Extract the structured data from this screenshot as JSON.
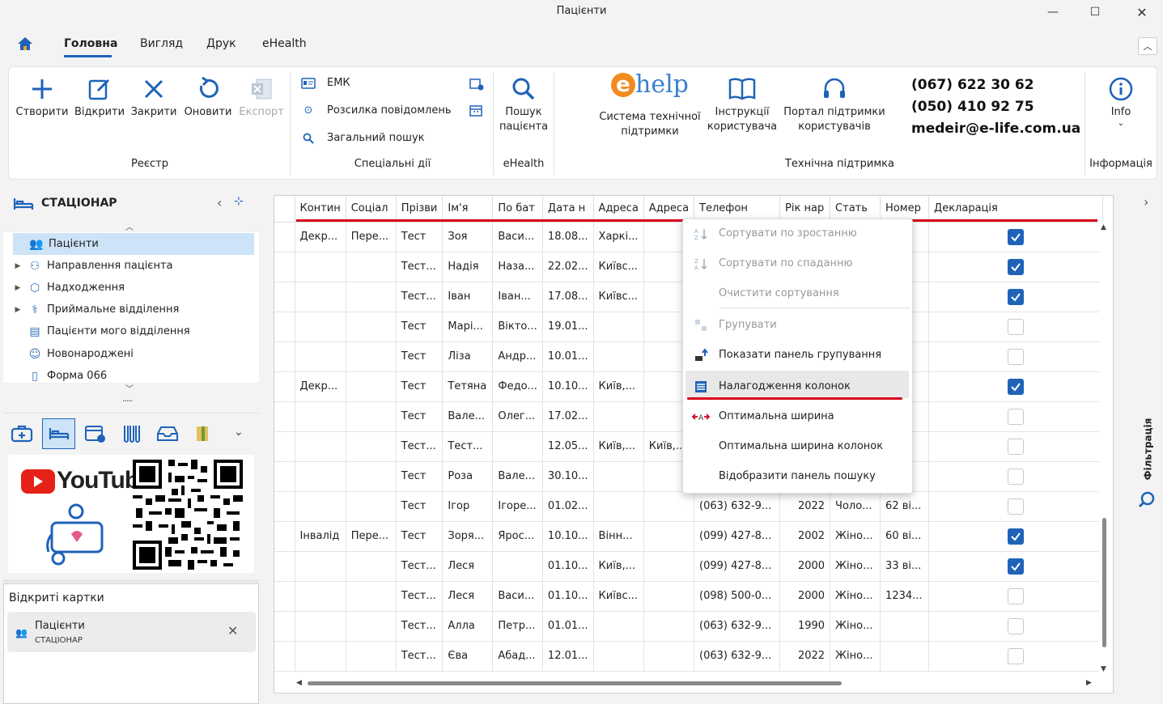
{
  "window": {
    "title": "Пацієнти"
  },
  "menu_tabs": [
    {
      "label": "Головна"
    },
    {
      "label": "Вигляд"
    },
    {
      "label": "Друк"
    },
    {
      "label": "eHealth"
    }
  ],
  "ribbon": {
    "registry_buttons": [
      {
        "label": "Створити"
      },
      {
        "label": "Відкрити"
      },
      {
        "label": "Закрити"
      },
      {
        "label": "Оновити"
      },
      {
        "label": "Експорт"
      }
    ],
    "registry_group": "Реєстр",
    "special_items": [
      {
        "label": "ЕМК"
      },
      {
        "label": "Розсилка повідомлень"
      },
      {
        "label": "Загальний пошук"
      }
    ],
    "special_group": "Спеціальні дії",
    "search_patient": {
      "line1": "Пошук",
      "line2": "пацієнта"
    },
    "ehealth_group": "eHealth",
    "logo": {
      "e": "e",
      "help": "help"
    },
    "support_buttons": [
      {
        "line1": "Система технічної",
        "line2": "підтримки"
      },
      {
        "line1": "Інструкції",
        "line2": "користувача"
      },
      {
        "line1": "Портал підтримки",
        "line2": "користувачів"
      }
    ],
    "contacts": [
      "(067) 622 30 62",
      "(050) 410 92 75",
      "medeir@e-life.com.ua"
    ],
    "support_group": "Технічна підтримка",
    "info_label": "Info",
    "info_group": "Інформація"
  },
  "left": {
    "section_title": "СТАЦІОНАР",
    "nav_items": [
      {
        "label": "Пацієнти"
      },
      {
        "label": "Направлення пацієнта"
      },
      {
        "label": "Надходження"
      },
      {
        "label": "Приймальне відділення"
      },
      {
        "label": "Пацієнти мого відділення"
      },
      {
        "label": "Новонароджені"
      },
      {
        "label": "Форма 066"
      }
    ],
    "more_dots": ".....",
    "youtube": "YouTube"
  },
  "open_cards": {
    "title": "Відкриті картки",
    "card_title": "Пацієнти",
    "card_sub": "СТАЦІОНАР"
  },
  "filter_label": "Фільтрація",
  "grid": {
    "columns": [
      "Контин",
      "Соціал",
      "Прізви",
      "Ім'я",
      "По бат",
      "Дата н",
      "Адреса",
      "Адреса",
      "Телефон",
      "Рік нар",
      "Стать",
      "Номер",
      "Декларація"
    ],
    "rows": [
      {
        "c": [
          "Декр...",
          "Пере...",
          "Тест",
          "Зоя",
          "Васи...",
          "18.08...",
          "Харкі...",
          "",
          "",
          "",
          "",
          "",
          ""
        ],
        "d": true
      },
      {
        "c": [
          "",
          "",
          "Тест...",
          "Надія",
          "Наза...",
          "22.02...",
          "Київс...",
          "",
          "",
          "",
          "",
          "",
          ""
        ],
        "d": true
      },
      {
        "c": [
          "",
          "",
          "Тест...",
          "Іван",
          "Іван...",
          "17.08...",
          "Київс...",
          "",
          "",
          "",
          "",
          "",
          ""
        ],
        "d": true
      },
      {
        "c": [
          "",
          "",
          "Тест",
          "Марі...",
          "Вікто...",
          "19.01...",
          "",
          "",
          "",
          "",
          "",
          "",
          ""
        ],
        "d": false
      },
      {
        "c": [
          "",
          "",
          "Тест",
          "Ліза",
          "Андр...",
          "10.01...",
          "",
          "",
          "",
          "",
          "",
          "",
          ""
        ],
        "d": false
      },
      {
        "c": [
          "Декр...",
          "",
          "Тест",
          "Тетяна",
          "Федо...",
          "10.10...",
          "Київ,...",
          "",
          "",
          "",
          "",
          "",
          ""
        ],
        "d": true
      },
      {
        "c": [
          "",
          "",
          "Тест",
          "Вале...",
          "Олег...",
          "17.02...",
          "",
          "",
          "",
          "",
          "",
          "",
          ""
        ],
        "d": false
      },
      {
        "c": [
          "",
          "",
          "Тест...",
          "Тест...",
          "",
          "12.05...",
          "Київ,...",
          "Київ,...",
          "",
          "",
          "",
          "",
          ""
        ],
        "d": false
      },
      {
        "c": [
          "",
          "",
          "Тест",
          "Роза",
          "Вале...",
          "30.10...",
          "",
          "",
          "",
          "",
          "",
          "",
          ""
        ],
        "d": false
      },
      {
        "c": [
          "",
          "",
          "Тест",
          "Ігор",
          "Ігоре...",
          "01.02...",
          "",
          "",
          "(063) 632-9...",
          "2022",
          "Чоло...",
          "62 ві...",
          ""
        ],
        "d": false
      },
      {
        "c": [
          "Інвалід",
          "Пере...",
          "Тест",
          "Зоря...",
          "Ярос...",
          "10.10...",
          "Вінн...",
          "",
          "(099) 427-8...",
          "2002",
          "Жіно...",
          "60 ві...",
          ""
        ],
        "d": true
      },
      {
        "c": [
          "",
          "",
          "Тест...",
          "Леся",
          "",
          "01.10...",
          "Київ,...",
          "",
          "(099) 427-8...",
          "2000",
          "Жіно...",
          "33 ві...",
          ""
        ],
        "d": true
      },
      {
        "c": [
          "",
          "",
          "Тест...",
          "Леся",
          "Васи...",
          "01.10...",
          "Київс...",
          "",
          "(098) 500-0...",
          "2000",
          "Жіно...",
          "1234...",
          ""
        ],
        "d": false
      },
      {
        "c": [
          "",
          "",
          "Тест...",
          "Алла",
          "Петр...",
          "01.01...",
          "",
          "",
          "(063) 632-9...",
          "1990",
          "Жіно...",
          "",
          ""
        ],
        "d": false
      },
      {
        "c": [
          "",
          "",
          "Тест...",
          "Єва",
          "Абад...",
          "12.01...",
          "",
          "",
          "(063) 632-9...",
          "2022",
          "Жіно...",
          "",
          ""
        ],
        "d": false
      }
    ]
  },
  "context_menu": [
    {
      "label": "Сортувати по зростанню",
      "disabled": true,
      "icon": "sort-asc-icon"
    },
    {
      "label": "Сортувати по спаданню",
      "disabled": true,
      "icon": "sort-desc-icon"
    },
    {
      "label": "Очистити сортування",
      "disabled": true,
      "icon": ""
    },
    {
      "label": "Групувати",
      "disabled": true,
      "icon": "group-icon"
    },
    {
      "label": "Показати панель групування",
      "disabled": false,
      "icon": "group-panel-icon"
    },
    {
      "label": "Налагодження колонок",
      "disabled": false,
      "icon": "columns-icon"
    },
    {
      "label": "Оптимальна ширина",
      "disabled": false,
      "icon": "best-fit-icon"
    },
    {
      "label": "Оптимальна ширина колонок",
      "disabled": false,
      "icon": ""
    },
    {
      "label": "Відобразити панель пошуку",
      "disabled": false,
      "icon": ""
    }
  ],
  "colors": {
    "accent": "#1f63b8",
    "highlight": "#d9001b",
    "selected": "#cde3f7"
  }
}
